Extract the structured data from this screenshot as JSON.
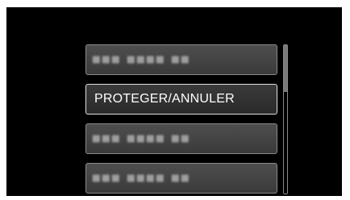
{
  "menu": {
    "items": [
      {
        "label": "",
        "blurred": true,
        "selected": false
      },
      {
        "label": "PROTEGER/ANNULER",
        "blurred": false,
        "selected": true
      },
      {
        "label": "",
        "blurred": true,
        "selected": false
      },
      {
        "label": "",
        "blurred": true,
        "selected": false
      }
    ]
  },
  "colors": {
    "screen_background": "#000000",
    "item_background": "#444444",
    "item_border": "#8a8a8a",
    "selected_border": "#e0e0e0",
    "text": "#ffffff"
  }
}
